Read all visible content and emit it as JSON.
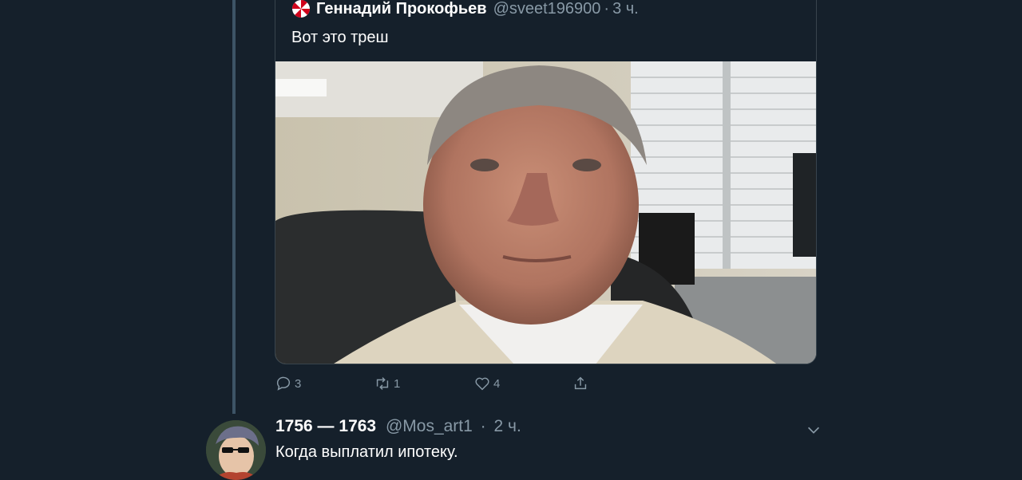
{
  "quoted_tweet": {
    "author_name": "Геннадий Прокофьев",
    "handle": "@sveet196900",
    "separator": "·",
    "time": "3 ч.",
    "text": "Вот это треш",
    "icons": {
      "author_badge": "umbrella-corp-icon"
    }
  },
  "actions": {
    "reply_count": "3",
    "retweet_count": "1",
    "like_count": "4"
  },
  "tweet": {
    "author_name": "1756 — 1763",
    "handle": "@Mos_art1",
    "separator": "·",
    "time": "2 ч.",
    "text": "Когда выплатил ипотеку."
  },
  "colors": {
    "background": "#15202b",
    "muted_text": "#8899a6",
    "border": "#38444d",
    "thread_line": "#3d5466"
  }
}
